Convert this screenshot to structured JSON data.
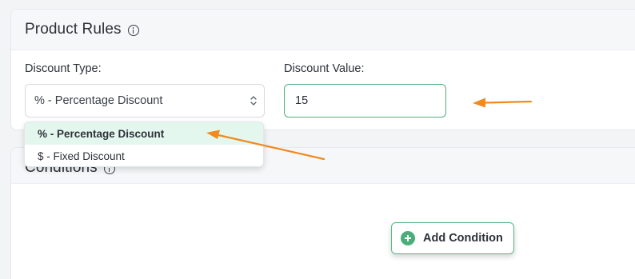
{
  "product_rules": {
    "title": "Product Rules",
    "info_icon": "info-circle-icon",
    "discount_type": {
      "label": "Discount Type:",
      "selected": "% - Percentage Discount",
      "options": [
        "% - Percentage Discount",
        "$ - Fixed Discount"
      ]
    },
    "discount_value": {
      "label": "Discount Value:",
      "value": "15"
    }
  },
  "conditions": {
    "title": "Conditions",
    "info_icon": "info-circle-icon",
    "add_button": {
      "label": "Add Condition",
      "icon": "plus-circle-icon"
    }
  },
  "colors": {
    "accent_green": "#4aae7a",
    "annotation_orange": "#f28a1e",
    "selected_option_bg": "#e4f7ee"
  }
}
